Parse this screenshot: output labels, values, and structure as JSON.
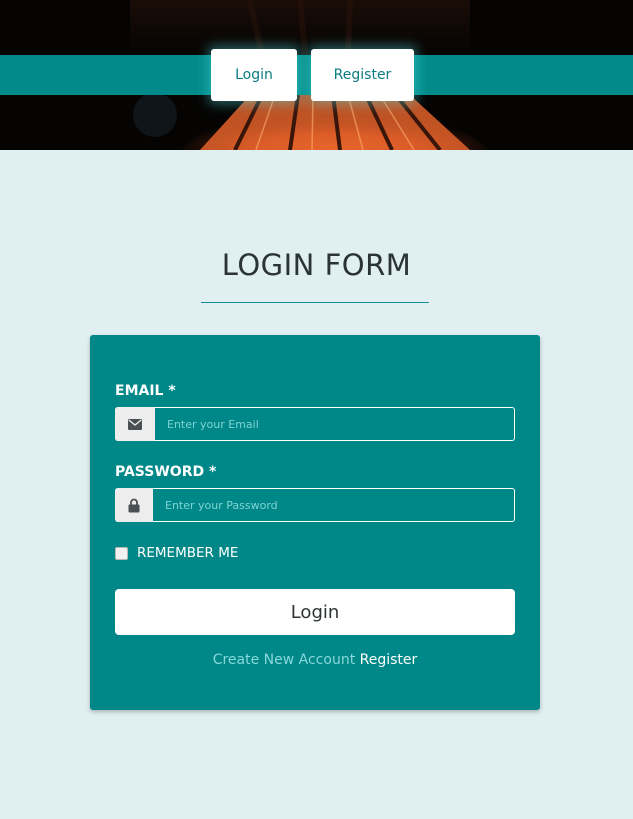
{
  "nav": {
    "login_label": "Login",
    "register_label": "Register"
  },
  "page": {
    "title": "LOGIN FORM"
  },
  "form": {
    "email_label": "EMAIL *",
    "email_placeholder": "Enter your Email",
    "email_value": "",
    "email_icon": "envelope-icon",
    "password_label": "PASSWORD *",
    "password_placeholder": "Enter your Password",
    "password_value": "",
    "password_icon": "lock-icon",
    "remember_label": "REMEMBER ME",
    "remember_checked": false,
    "submit_label": "Login",
    "create_text": "Create New Account",
    "register_link": "Register"
  },
  "colors": {
    "accent": "#008787",
    "background": "#e0eff2",
    "hero_dark": "#050403",
    "hero_wood": "#e9622a"
  }
}
